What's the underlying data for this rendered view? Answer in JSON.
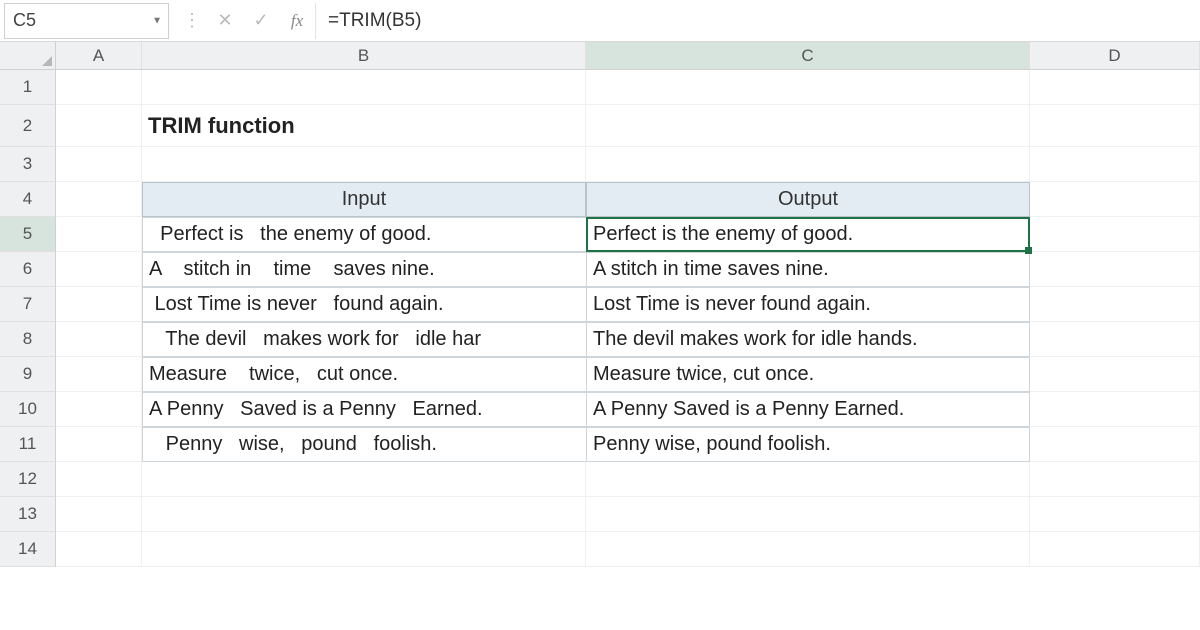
{
  "formula_bar": {
    "name_box": "C5",
    "cancel_glyph": "✕",
    "confirm_glyph": "✓",
    "fx_glyph": "fx",
    "formula": "=TRIM(B5)"
  },
  "columns": [
    "A",
    "B",
    "C",
    "D"
  ],
  "row_numbers": [
    "1",
    "2",
    "3",
    "4",
    "5",
    "6",
    "7",
    "8",
    "9",
    "10",
    "11",
    "12",
    "13",
    "14"
  ],
  "title": "TRIM function",
  "headers": {
    "input": "Input",
    "output": "Output"
  },
  "table": [
    {
      "input": "  Perfect is   the enemy of good.",
      "output": "Perfect is the enemy of good."
    },
    {
      "input": "A    stitch in    time    saves nine.",
      "output": "A stitch in time saves nine."
    },
    {
      "input": " Lost Time is never   found again.",
      "output": "Lost Time is never found again."
    },
    {
      "input": "   The devil   makes work for   idle har",
      "output": "The devil makes work for idle hands."
    },
    {
      "input": "Measure    twice,   cut once.",
      "output": "Measure twice, cut once."
    },
    {
      "input": "A Penny   Saved is a Penny   Earned.",
      "output": "A Penny Saved is a Penny Earned."
    },
    {
      "input": "   Penny   wise,   pound   foolish.",
      "output": "Penny wise, pound foolish."
    }
  ],
  "selected_cell": "C5"
}
